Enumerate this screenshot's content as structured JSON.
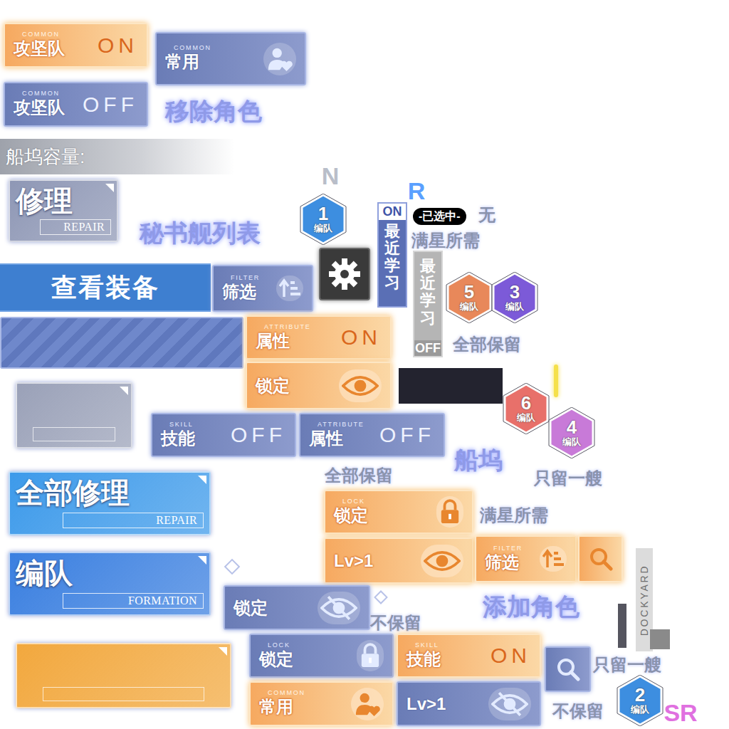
{
  "sprites": [
    {
      "kind": "toggle",
      "caption": "COMMON",
      "label": "攻坚队",
      "state": "ON",
      "selected": true
    },
    {
      "kind": "heartbtn",
      "caption": "COMMON",
      "label": "常用",
      "selected": false
    },
    {
      "kind": "toggle",
      "caption": "COMMON",
      "label": "攻坚队",
      "state": "OFF",
      "selected": false
    },
    {
      "kind": "glow",
      "text": "移除角色"
    },
    {
      "kind": "capacity",
      "text": "船坞容量:"
    },
    {
      "kind": "card",
      "label": "修理",
      "sub": "REPAIR",
      "color": "#8e97b5"
    },
    {
      "kind": "glow",
      "text": "秘书舰列表"
    },
    {
      "kind": "rarity",
      "text": "N",
      "color": "#b9bec9"
    },
    {
      "kind": "hex",
      "num": "1",
      "label": "编队",
      "color": "#3d8ee0"
    },
    {
      "kind": "rarity",
      "text": "R",
      "color": "#5aa0ff"
    },
    {
      "kind": "vtab",
      "state": "ON",
      "label": "最近学习",
      "selected": true
    },
    {
      "kind": "pill",
      "text": "-已选中-"
    },
    {
      "kind": "text",
      "text": "无"
    },
    {
      "kind": "text",
      "text": "满星所需"
    },
    {
      "kind": "vtab",
      "state": "OFF",
      "label": "最近学习",
      "selected": false
    },
    {
      "kind": "bar",
      "text": "查看装备"
    },
    {
      "kind": "filterbtn",
      "caption": "FILTER",
      "label": "筛选",
      "selected": false
    },
    {
      "kind": "gearbtn"
    },
    {
      "kind": "hex",
      "num": "5",
      "label": "编队",
      "color": "#e8885a"
    },
    {
      "kind": "hex",
      "num": "3",
      "label": "编队",
      "color": "#7c5ad8"
    },
    {
      "kind": "stripe"
    },
    {
      "kind": "toggle",
      "caption": "ATTRIBUTE",
      "label": "属性",
      "state": "ON",
      "selected": true
    },
    {
      "kind": "eyebtn",
      "label": "锁定",
      "selected": true
    },
    {
      "kind": "text",
      "text": "全部保留"
    },
    {
      "kind": "block"
    },
    {
      "kind": "line",
      "color": "#f5e04a"
    },
    {
      "kind": "blankcard",
      "color": "#9aa1b8"
    },
    {
      "kind": "toggle",
      "caption": "SKILL",
      "label": "技能",
      "state": "OFF",
      "selected": false
    },
    {
      "kind": "toggle",
      "caption": "ATTRIBUTE",
      "label": "属性",
      "state": "OFF",
      "selected": false
    },
    {
      "kind": "glow",
      "text": "船坞"
    },
    {
      "kind": "hex",
      "num": "6",
      "label": "编队",
      "color": "#e8706a"
    },
    {
      "kind": "hex",
      "num": "4",
      "label": "编队",
      "color": "#c87ad8"
    },
    {
      "kind": "text",
      "text": "只留一艘"
    },
    {
      "kind": "text",
      "text": "全部保留"
    },
    {
      "kind": "card",
      "label": "全部修理",
      "sub": "REPAIR",
      "color": "#3d9aea"
    },
    {
      "kind": "lockbtn",
      "caption": "LOCK",
      "label": "锁定",
      "selected": true
    },
    {
      "kind": "text",
      "text": "满星所需"
    },
    {
      "kind": "eyebtn",
      "label": "Lv>1",
      "selected": true
    },
    {
      "kind": "filterbtn",
      "caption": "FILTER",
      "label": "筛选",
      "selected": true
    },
    {
      "kind": "searchbtn",
      "selected": true
    },
    {
      "kind": "dockyard",
      "text": "DOCKYARD"
    },
    {
      "kind": "card",
      "label": "编队",
      "sub": "FORMATION",
      "color": "#3a7fe0"
    },
    {
      "kind": "eyeoffbtn",
      "label": "锁定",
      "selected": false
    },
    {
      "kind": "glow",
      "text": "添加角色"
    },
    {
      "kind": "text",
      "text": "不保留"
    },
    {
      "kind": "blankcard",
      "color": "#f2a83e"
    },
    {
      "kind": "lockbtn",
      "caption": "LOCK",
      "label": "锁定",
      "selected": false
    },
    {
      "kind": "toggle",
      "caption": "SKILL",
      "label": "技能",
      "state": "ON",
      "selected": true
    },
    {
      "kind": "searchbtn",
      "selected": false
    },
    {
      "kind": "text",
      "text": "只留一艘"
    },
    {
      "kind": "heartbtn",
      "caption": "COMMON",
      "label": "常用",
      "selected": true
    },
    {
      "kind": "eyeoffbtn",
      "label": "Lv>1",
      "selected": false
    },
    {
      "kind": "text",
      "text": "不保留"
    },
    {
      "kind": "hex",
      "num": "2",
      "label": "编队",
      "color": "#3d8ee0"
    },
    {
      "kind": "rarity",
      "text": "SR",
      "color": "#e070e0"
    }
  ]
}
